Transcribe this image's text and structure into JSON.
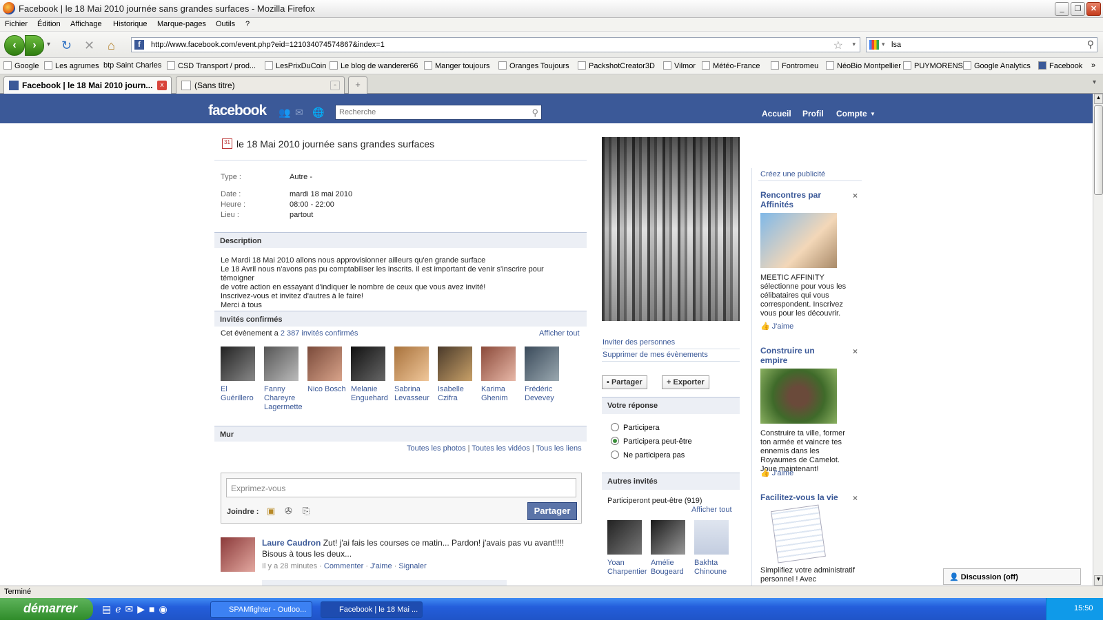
{
  "window": {
    "title": "Facebook | le 18 Mai 2010 journée sans grandes surfaces - Mozilla Firefox"
  },
  "menu": [
    "Fichier",
    "Édition",
    "Affichage",
    "Historique",
    "Marque-pages",
    "Outils",
    "?"
  ],
  "nav": {
    "url": "http://www.facebook.com/event.php?eid=121034074574867&index=1",
    "search_value": "lsa"
  },
  "bookmarks": [
    "Google",
    "Les agrumes",
    "btp Saint Charles",
    "CSD Transport / prod...",
    "LesPrixDuCoin",
    "Le blog de wanderer66",
    "Manger toujours",
    "Oranges Toujours",
    "PackshotCreator3D",
    "Vilmor",
    "Météo-France",
    "Fontromeu",
    "NéoBio Montpellier",
    "PUYMORENS",
    "Google Analytics",
    "Facebook"
  ],
  "tabs": [
    {
      "label": "Facebook | le 18 Mai 2010 journ...",
      "close": "x"
    },
    {
      "label": "(Sans titre)"
    }
  ],
  "fb": {
    "logo": "facebook",
    "search_placeholder": "Recherche",
    "nav": {
      "home": "Accueil",
      "profile": "Profil",
      "account": "Compte"
    }
  },
  "event": {
    "title": "le 18 Mai 2010 journée sans grandes surfaces",
    "type_label": "Type :",
    "type_value": "Autre -",
    "date_label": "Date :",
    "date_value": "mardi 18 mai 2010",
    "time_label": "Heure :",
    "time_value": "08:00 - 22:00",
    "place_label": "Lieu :",
    "place_value": "partout",
    "description_header": "Description",
    "description_lines": [
      "Le Mardi 18 Mai 2010 allons nous approvisionner ailleurs qu'en grande surface",
      "Le 18 Avril nous n'avons pas pu comptabiliser les inscrits. Il est important de venir s'inscrire pour témoigner",
      "de votre action en essayant d'indiquer le nombre de ceux que vous avez invité!",
      "Inscrivez-vous et invitez d'autres à le faire!",
      "Merci à tous"
    ],
    "confirmed_header": "Invités confirmés",
    "confirmed_prefix": "Cet évènement a",
    "confirmed_link": "2 387 invités confirmés",
    "show_all": "Afficher tout",
    "guests": [
      {
        "name": "El Guérillero"
      },
      {
        "name": "Fanny Chareyre Lagermette"
      },
      {
        "name": "Nico Bosch"
      },
      {
        "name": "Melanie Enguehard"
      },
      {
        "name": "Sabrina Levasseur"
      },
      {
        "name": "Isabelle Czifra"
      },
      {
        "name": "Karima Ghenim"
      },
      {
        "name": "Frédéric Devevey"
      }
    ],
    "wall_header": "Mur",
    "wall_links": [
      "Toutes les photos",
      "Toutes les vidéos",
      "Tous les liens"
    ],
    "composer_placeholder": "Exprimez-vous",
    "attach_label": "Joindre :",
    "share_button": "Partager",
    "post": {
      "author": "Laure Caudron",
      "text": "Zut! j'ai fais les courses ce matin... Pardon! j'avais pas vu avant!!!! Bisous à tous les deux...",
      "time": "Il y a 28 minutes",
      "actions": [
        "Commenter",
        "J'aime",
        "Signaler"
      ]
    }
  },
  "sidebar": {
    "invite": "Inviter des personnes",
    "remove": "Supprimer de mes évènements",
    "share_btn": "Partager",
    "export_btn": "Exporter",
    "response_header": "Votre réponse",
    "responses": [
      {
        "label": "Participera",
        "selected": false
      },
      {
        "label": "Participera peut-être",
        "selected": true
      },
      {
        "label": "Ne participera pas",
        "selected": false
      }
    ],
    "others_header": "Autres invités",
    "maybe_label": "Participeront peut-être (919)",
    "show_all": "Afficher tout",
    "others": [
      {
        "name": "Yoan Charpentier"
      },
      {
        "name": "Amélie Bougeard"
      },
      {
        "name": "Bakhta Chinoune"
      }
    ]
  },
  "ads": {
    "create": "Créez une publicité",
    "items": [
      {
        "title": "Rencontres par Affinités",
        "text": "MEETIC AFFINITY sélectionne pour vous les célibataires qui vous correspondent. Inscrivez vous pour les découvrir.",
        "like": "J'aime"
      },
      {
        "title": "Construire un empire",
        "text": "Construire ta ville, former ton armée et vaincre tes ennemis dans les Royaumes de Camelot. Joue maintenant!",
        "like": "J'aime"
      },
      {
        "title": "Facilitez-vous la vie",
        "text": "Simplifiez votre administratif personnel ! Avec"
      }
    ]
  },
  "chat": "Discussion (off)",
  "status": "Terminé",
  "taskbar": {
    "start": "démarrer",
    "tasks": [
      "SPAMfighter - Outloo...",
      "Facebook | le 18 Mai ..."
    ],
    "clock": "15:50"
  }
}
